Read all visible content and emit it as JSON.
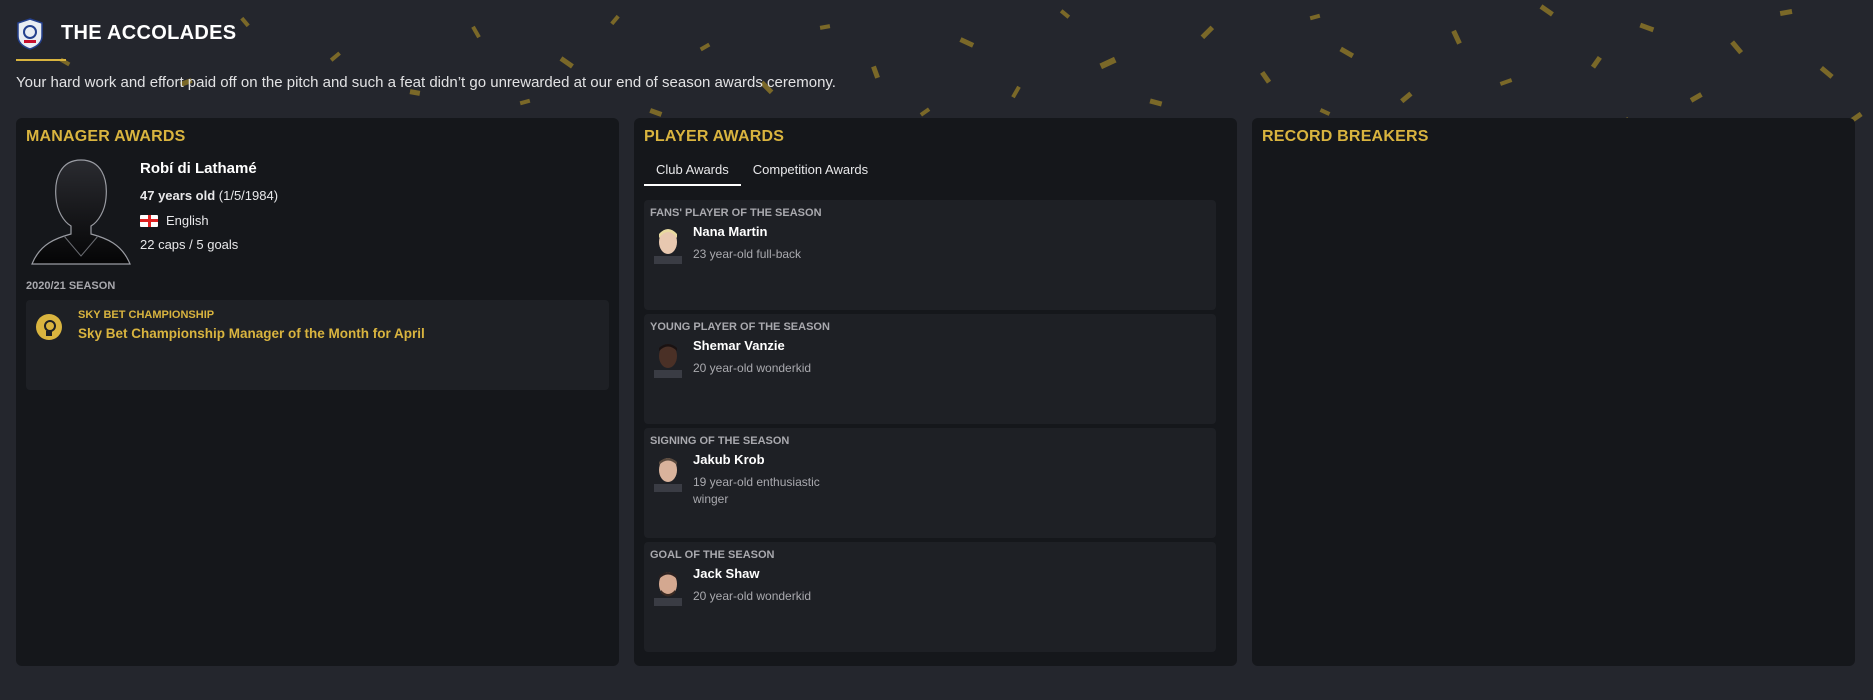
{
  "header": {
    "title": "THE ACCOLADES",
    "intro": "Your hard work and effort paid off on the pitch and such a feat didn’t go unrewarded at our end of season awards ceremony."
  },
  "colors": {
    "accent": "#d9b43f",
    "panel_bg": "#15171b",
    "page_bg": "#24262d"
  },
  "manager_awards": {
    "title": "MANAGER AWARDS",
    "name": "Robí di Lathamé",
    "age": "47 years old",
    "dob": "(1/5/1984)",
    "nationality": "English",
    "nationality_flag": "england-flag",
    "caps_goals": "22 caps / 5 goals",
    "season_label": "2020/21 SEASON",
    "awards": [
      {
        "competition": "SKY BET CHAMPIONSHIP",
        "name": "Sky Bet Championship Manager of the Month for April",
        "icon": "award-medal-icon"
      }
    ]
  },
  "player_awards": {
    "title": "PLAYER AWARDS",
    "tabs": [
      {
        "label": "Club Awards",
        "active": true
      },
      {
        "label": "Competition Awards",
        "active": false
      }
    ],
    "cards": [
      {
        "category": "FANS' PLAYER OF THE SEASON",
        "player": "Nana Martin",
        "description": "23 year-old full-back"
      },
      {
        "category": "YOUNG PLAYER OF THE SEASON",
        "player": "Shemar Vanzie",
        "description": "20 year-old wonderkid"
      },
      {
        "category": "SIGNING OF THE SEASON",
        "player": "Jakub Krob",
        "description": "19 year-old enthusiastic winger"
      },
      {
        "category": "GOAL OF THE SEASON",
        "player": "Jack Shaw",
        "description": "20 year-old wonderkid"
      }
    ]
  },
  "record_breakers": {
    "title": "RECORD BREAKERS"
  }
}
